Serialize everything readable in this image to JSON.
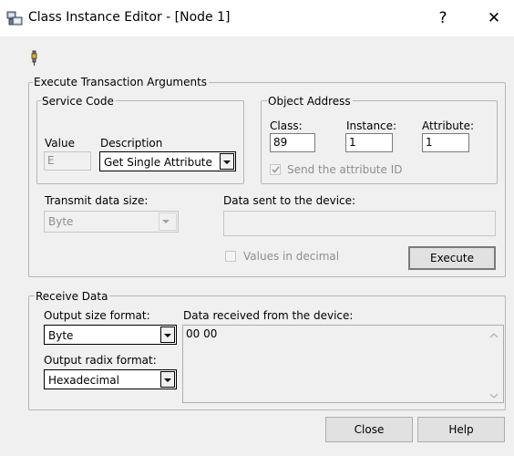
{
  "window": {
    "title": "Class Instance Editor - [Node 1]",
    "help_glyph": "?",
    "close_glyph": "✕"
  },
  "execute_group": {
    "label": "Execute Transaction Arguments",
    "service_code": {
      "label": "Service Code",
      "value_label": "Value",
      "value": "E",
      "description_label": "Description",
      "description": "Get Single Attribute"
    },
    "object_address": {
      "label": "Object Address",
      "class_label": "Class:",
      "class_value": "89",
      "instance_label": "Instance:",
      "instance_value": "1",
      "attribute_label": "Attribute:",
      "attribute_value": "1",
      "send_attribute_id_label": "Send the attribute ID",
      "send_attribute_id_checked": true
    },
    "transmit_size_label": "Transmit data size:",
    "transmit_size_value": "Byte",
    "data_sent_label": "Data sent to the device:",
    "data_sent_value": "",
    "values_in_decimal_label": "Values in decimal",
    "values_in_decimal_checked": false,
    "execute_button": "Execute"
  },
  "receive_group": {
    "label": "Receive Data",
    "output_size_label": "Output size format:",
    "output_size_value": "Byte",
    "output_radix_label": "Output radix format:",
    "output_radix_value": "Hexadecimal",
    "data_received_label": "Data received from the device:",
    "data_received_value": "00 00"
  },
  "footer": {
    "close_button": "Close",
    "help_button": "Help"
  }
}
